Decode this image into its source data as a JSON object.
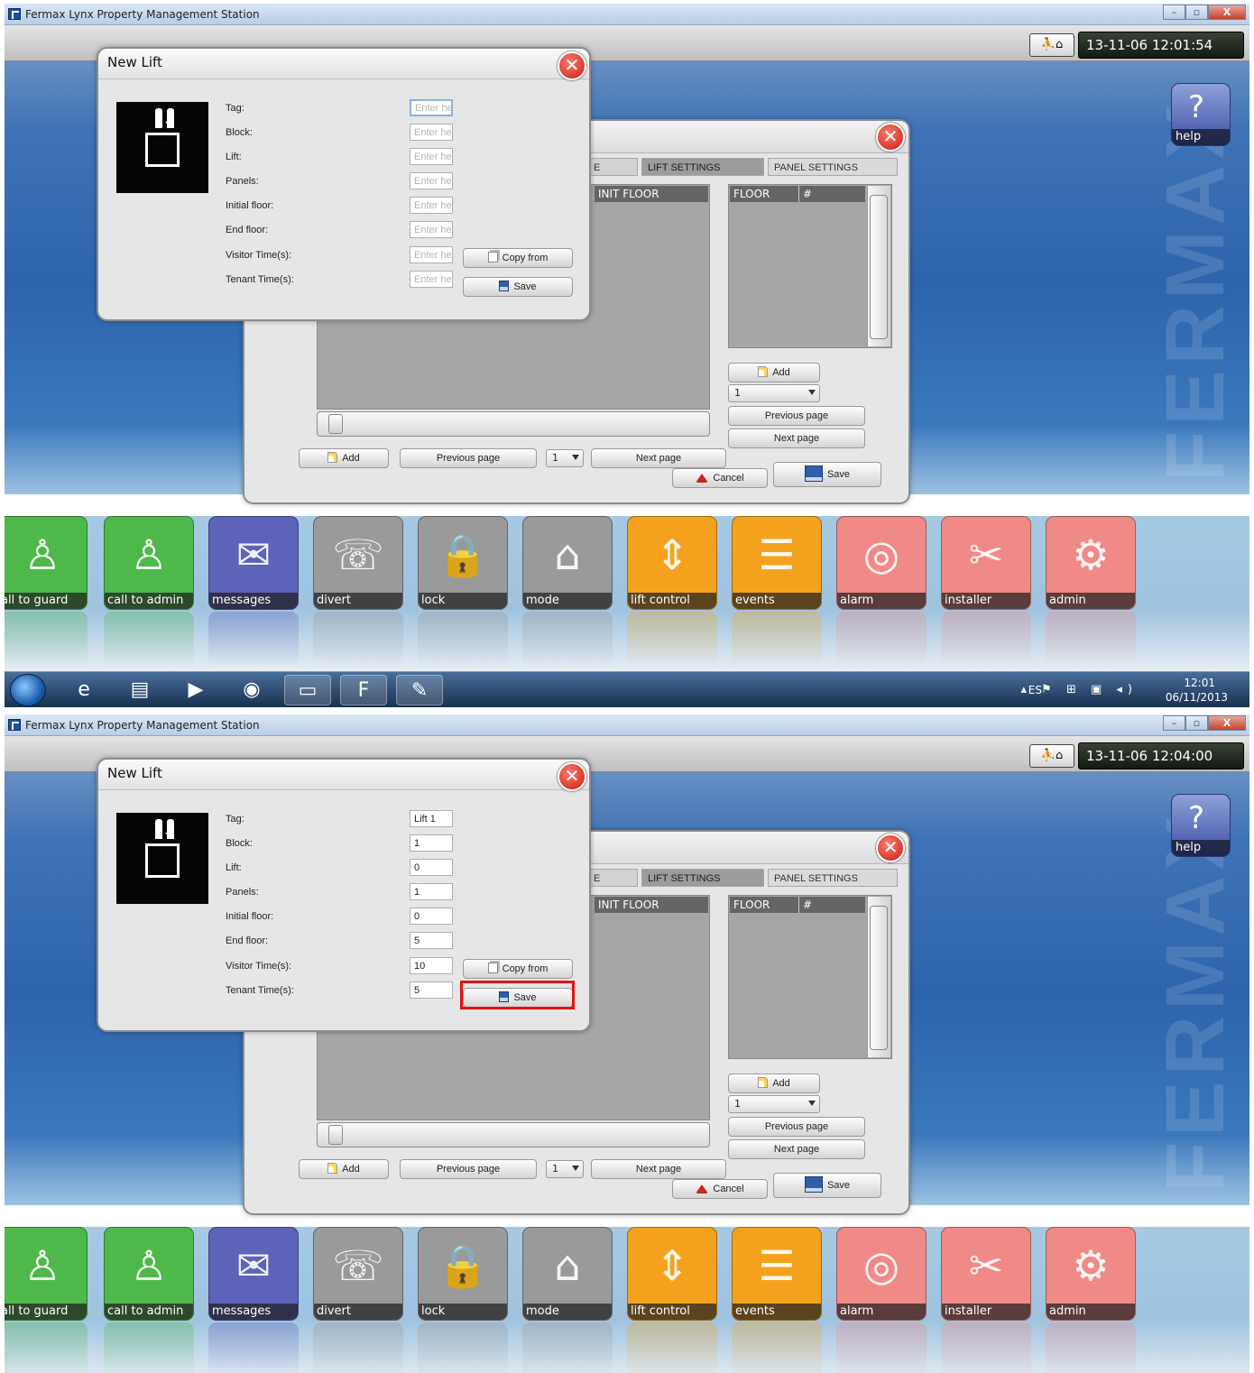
{
  "app": {
    "window_title": "Fermax Lynx Property Management Station",
    "window_buttons": [
      "–",
      "▫",
      "X"
    ],
    "help_label": "help",
    "watermark": "FERMAX"
  },
  "shots": [
    {
      "clock": "13-11-06 12:01:54"
    },
    {
      "clock": "13-11-06 12:04:00"
    }
  ],
  "lift_dialog": {
    "title": "New Lift",
    "fields": [
      {
        "label": "Tag:",
        "placeholder": "Enter he"
      },
      {
        "label": "Block:",
        "placeholder": "Enter he"
      },
      {
        "label": "Lift:",
        "placeholder": "Enter he"
      },
      {
        "label": "Panels:",
        "placeholder": "Enter he"
      },
      {
        "label": "Initial floor:",
        "placeholder": "Enter he"
      },
      {
        "label": "End floor:",
        "placeholder": "Enter he"
      },
      {
        "label": "Visitor Time(s):",
        "placeholder": "Enter he"
      },
      {
        "label": "Tenant Time(s):",
        "placeholder": "Enter he"
      }
    ],
    "filled_values": [
      "Lift 1",
      "1",
      "0",
      "1",
      "0",
      "5",
      "10",
      "5"
    ],
    "copy_from_label": "Copy from",
    "save_label": "Save"
  },
  "settings_dialog": {
    "tabs": [
      "E",
      "LIFT SETTINGS",
      "PANEL SETTINGS"
    ],
    "active_tab": "LIFT SETTINGS",
    "left_table": {
      "column": "INIT FLOOR"
    },
    "right_table": {
      "columns": [
        "FLOOR",
        "#"
      ]
    },
    "right_add": "Add",
    "right_page_select": "1",
    "right_previous": "Previous page",
    "right_next": "Next page",
    "bottom_add": "Add",
    "bottom_previous": "Previous page",
    "bottom_page_select": "1",
    "bottom_next": "Next page",
    "cancel": "Cancel",
    "save": "Save"
  },
  "dock": {
    "items": [
      {
        "label": "all to guard",
        "color": "#4fb84a",
        "icon": "guard-icon"
      },
      {
        "label": "call to admin",
        "color": "#4fb84a",
        "icon": "admin-person-icon"
      },
      {
        "label": "messages",
        "color": "#5d63b9",
        "icon": "envelope-icon"
      },
      {
        "label": "divert",
        "color": "#9a9a9a",
        "icon": "phone-divert-icon"
      },
      {
        "label": "lock",
        "color": "#9a9a9a",
        "icon": "padlock-icon"
      },
      {
        "label": "mode",
        "color": "#9a9a9a",
        "icon": "house-gear-icon"
      },
      {
        "label": "lift control",
        "color": "#f4a21e",
        "icon": "lift-icon"
      },
      {
        "label": "events",
        "color": "#f4a21e",
        "icon": "document-stack-icon"
      },
      {
        "label": "alarm",
        "color": "#f08a86",
        "icon": "alarm-bell-icon"
      },
      {
        "label": "installer",
        "color": "#f08a86",
        "icon": "tools-icon"
      },
      {
        "label": "admin",
        "color": "#f08a86",
        "icon": "admin-gear-icon"
      }
    ]
  },
  "taskbar": {
    "lang": "ES",
    "tray_glyphs": "▴ ⚑ ⊞ ▣ ◂)",
    "time": "12:01",
    "date": "06/11/2013",
    "pinned": [
      {
        "icon": "internet-explorer-icon",
        "glyph": "e"
      },
      {
        "icon": "file-explorer-icon",
        "glyph": "▤"
      },
      {
        "icon": "media-player-icon",
        "glyph": "▶"
      },
      {
        "icon": "chrome-icon",
        "glyph": "◉"
      },
      {
        "icon": "remote-desktop-icon",
        "glyph": "▭"
      },
      {
        "icon": "fermax-app-icon",
        "glyph": "F"
      },
      {
        "icon": "paint-icon",
        "glyph": "✎"
      }
    ]
  }
}
